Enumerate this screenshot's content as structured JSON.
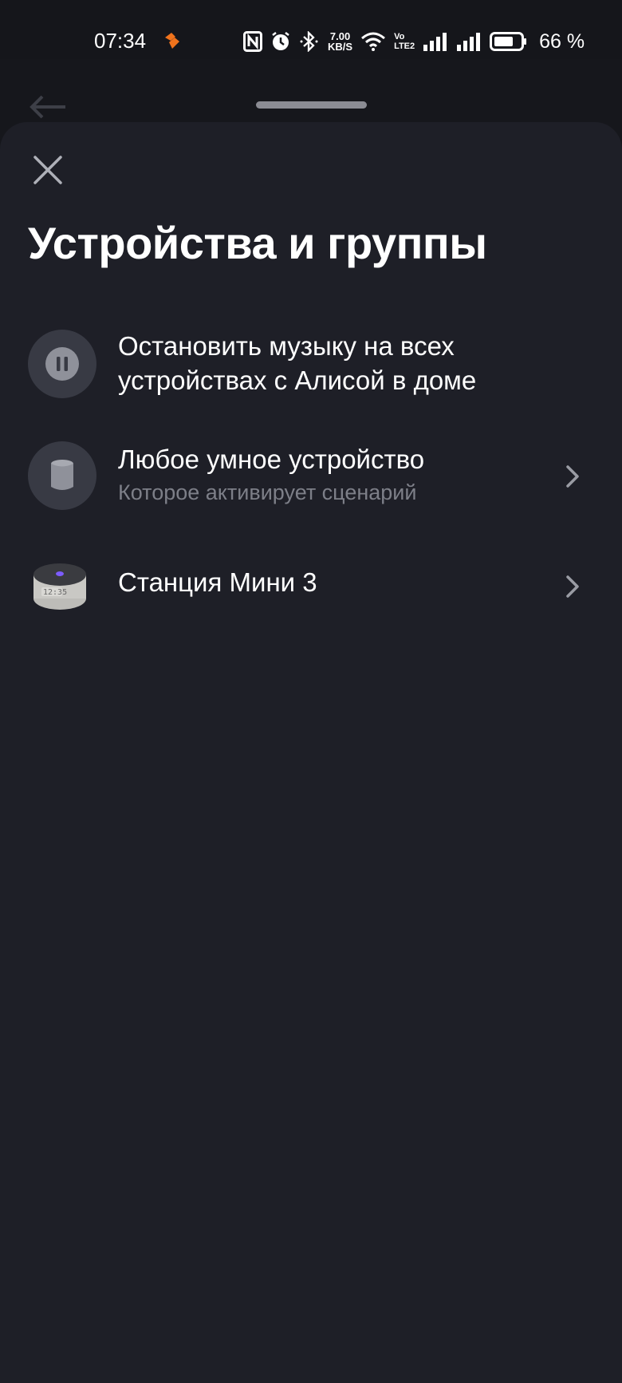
{
  "status_bar": {
    "time": "07:34",
    "net_speed_value": "7.00",
    "net_speed_unit": "KB/S",
    "volte_top": "Vo",
    "volte_bottom": "LTE2",
    "battery_percent": "66 %",
    "heart_color": "#f0731c"
  },
  "sheet": {
    "title": "Устройства и группы"
  },
  "items": [
    {
      "icon": "pause-icon",
      "title": "Остановить музыку на всех устройствах с Алисой в доме",
      "subtitle": "",
      "has_chevron": false
    },
    {
      "icon": "smart-device-icon",
      "title": "Любое умное устройство",
      "subtitle": "Которое активирует сценарий",
      "has_chevron": true
    },
    {
      "icon": "station-mini-image",
      "title": "Станция Мини 3",
      "subtitle": "",
      "has_chevron": true
    }
  ],
  "station_display": "12:35",
  "colors": {
    "sheet_bg": "#1e1f27",
    "status_bg": "#15161b",
    "icon_circle_bg": "#383a44",
    "subtitle": "#7d7f88",
    "chevron": "#9a9ca4"
  }
}
